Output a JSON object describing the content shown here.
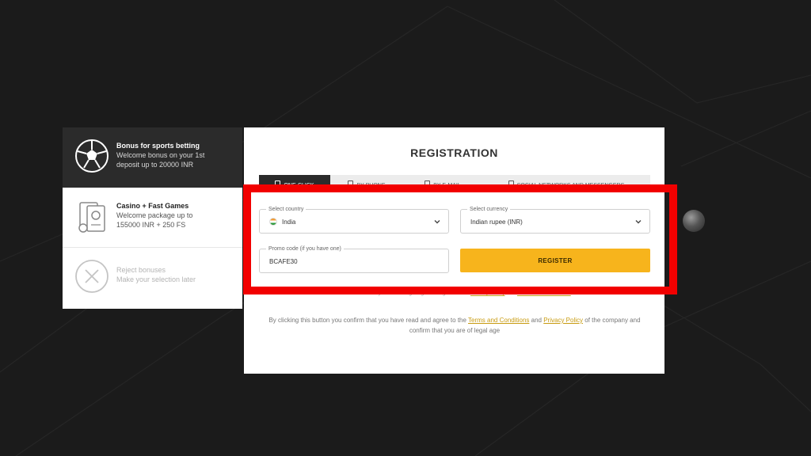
{
  "bonuses": [
    {
      "title": "Bonus for sports betting",
      "line1": "Welcome bonus on your 1st",
      "line2": "deposit up to 20000 INR",
      "icon": "soccer-ball-icon",
      "active": true
    },
    {
      "title": "Casino + Fast Games",
      "line1": "Welcome package up to",
      "line2": "155000 INR + 250 FS",
      "icon": "casino-chips-icon",
      "active": false
    },
    {
      "title": "Reject bonuses",
      "line1": "Make your selection later",
      "line2": "",
      "icon": "close-circle-icon",
      "active": false
    }
  ],
  "registration": {
    "title": "REGISTRATION",
    "tabs": [
      {
        "label": "ONE-CLICK",
        "icon": "lightning-icon"
      },
      {
        "label": "BY PHONE",
        "icon": "phone-icon"
      },
      {
        "label": "BY E-MAIL",
        "icon": "envelope-icon"
      },
      {
        "label": "SOCIAL NETWORKS AND MESSENGERS",
        "icon": "users-icon"
      }
    ],
    "country": {
      "label": "Select country",
      "value": "India"
    },
    "currency": {
      "label": "Select currency",
      "value": "Indian rupee (INR)"
    },
    "promo": {
      "label": "Promo code (if you have one)",
      "value": "BCAFE30"
    },
    "register_label": "REGISTER",
    "hidden_note": {
      "text": "You confirm that you are of legal age and agree to the",
      "link1": "Privacy Policy",
      "mid": "and",
      "link2": "Terms and Conditions"
    },
    "terms": {
      "part1": "By clicking this button you confirm that you have read and agree to the",
      "link1": "Terms and Conditions",
      "part2": "and",
      "link2": "Privacy Policy",
      "part3": "of the company and confirm that you are of legal age"
    }
  },
  "colors": {
    "accent": "#f7b41c",
    "highlight": "#f20000",
    "background": "#1b1b1b",
    "active_tab": "#2b2b2b"
  }
}
